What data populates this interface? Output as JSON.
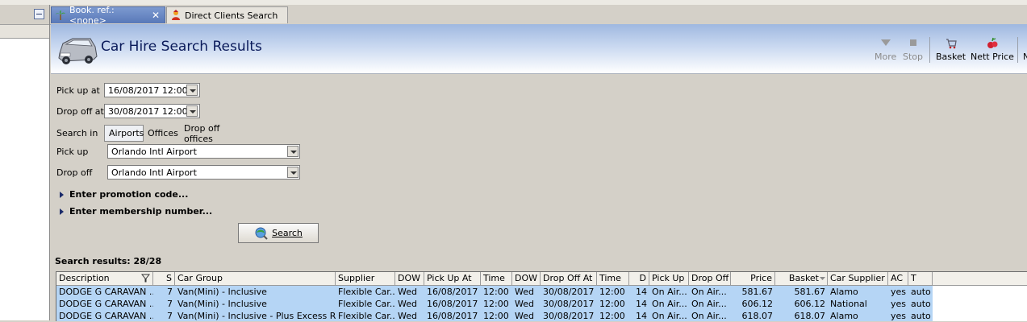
{
  "tabs": [
    {
      "label": "Book. ref.: <none>",
      "active": true,
      "icon": "palm-tree-icon"
    },
    {
      "label": "Direct Clients Search",
      "active": false,
      "icon": "person-icon"
    }
  ],
  "header": {
    "title": "Car Hire Search Results",
    "icon": "car-icon"
  },
  "toolbar": {
    "more": "More",
    "stop": "Stop",
    "basket": "Basket",
    "nett_price": "Nett Price",
    "overflow": "N"
  },
  "form": {
    "pickup_at_label": "Pick up at",
    "pickup_at_value": "16/08/2017 12:00",
    "dropoff_at_label": "Drop off at",
    "dropoff_at_value": "30/08/2017 12:00",
    "search_in_label": "Search in",
    "search_in_options": [
      "Airports",
      "Offices",
      "Drop off offices"
    ],
    "search_in_selected": "Airports",
    "pickup_label": "Pick up",
    "pickup_value": "Orlando Intl Airport",
    "dropoff_label": "Drop off",
    "dropoff_value": "Orlando Intl Airport",
    "promotion_label": "Enter promotion code...",
    "membership_label": "Enter membership number...",
    "search_button": "Search"
  },
  "results": {
    "label": "Search results: 28/28",
    "columns": [
      "Description",
      "S",
      "Car Group",
      "Supplier",
      "DOW",
      "Pick Up At",
      "Time",
      "DOW",
      "Drop Off At",
      "Time",
      "D",
      "Pick Up",
      "Drop Off",
      "Price",
      "Basket",
      "Car Supplier",
      "AC",
      "T"
    ],
    "rows": [
      [
        "DODGE G CARAVAN ...",
        "7",
        "Van(Mini) - Inclusive",
        "Flexible Car...",
        "Wed",
        "16/08/2017",
        "12:00",
        "Wed",
        "30/08/2017",
        "12:00",
        "14",
        "On Air...",
        "On Air...",
        "581.67",
        "581.67",
        "Alamo",
        "yes",
        "auto"
      ],
      [
        "DODGE G CARAVAN ...",
        "7",
        "Van(Mini) - Inclusive",
        "Flexible Car...",
        "Wed",
        "16/08/2017",
        "12:00",
        "Wed",
        "30/08/2017",
        "12:00",
        "14",
        "On Air...",
        "On Air...",
        "606.12",
        "606.12",
        "National",
        "yes",
        "auto"
      ],
      [
        "DODGE G CARAVAN ...",
        "7",
        "Van(Mini) - Inclusive - Plus Excess Ref...",
        "Flexible Car...",
        "Wed",
        "16/08/2017",
        "12:00",
        "Wed",
        "30/08/2017",
        "12:00",
        "14",
        "On Air...",
        "On Air...",
        "618.07",
        "618.07",
        "Alamo",
        "yes",
        "auto"
      ]
    ]
  },
  "colors": {
    "banner_top": "#9fb8e0",
    "active_tab": "#5878b8",
    "row_selected": "#b5d5f5",
    "title_text": "#0a1a5a"
  }
}
